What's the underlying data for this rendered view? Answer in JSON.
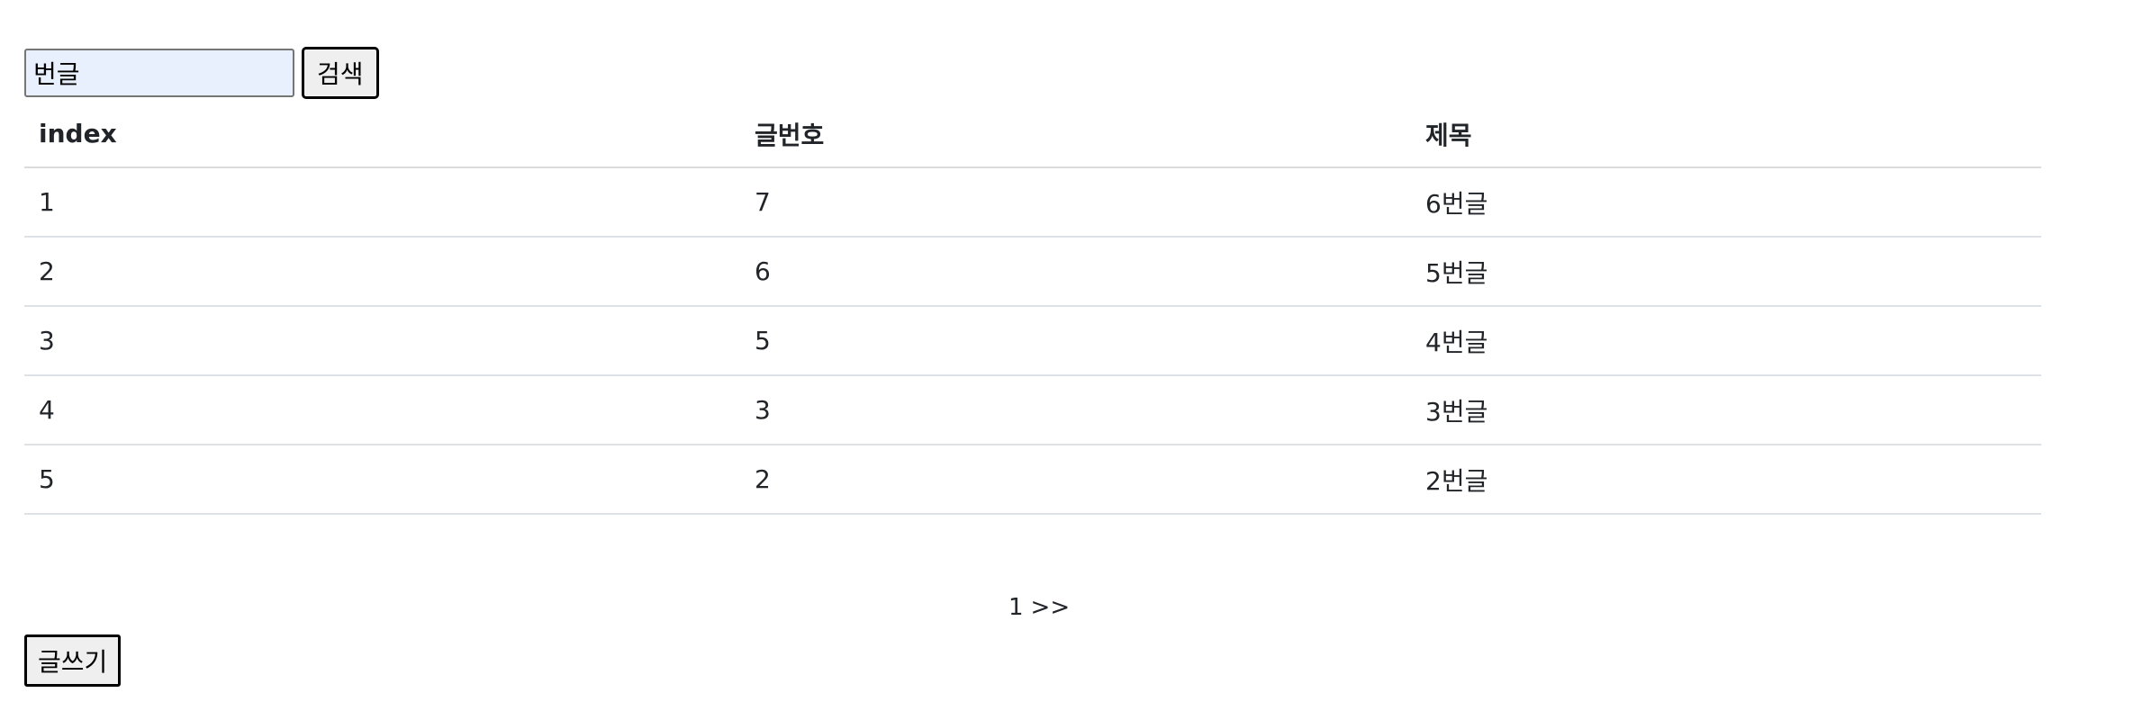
{
  "search": {
    "value": "번글",
    "button_label": "검색"
  },
  "table": {
    "headers": [
      "index",
      "글번호",
      "제목"
    ],
    "rows": [
      {
        "index": "1",
        "post_no": "7",
        "title": "6번글"
      },
      {
        "index": "2",
        "post_no": "6",
        "title": "5번글"
      },
      {
        "index": "3",
        "post_no": "5",
        "title": "4번글"
      },
      {
        "index": "4",
        "post_no": "3",
        "title": "3번글"
      },
      {
        "index": "5",
        "post_no": "2",
        "title": "2번글"
      }
    ]
  },
  "pagination": {
    "current_page": "1",
    "next_label": ">>"
  },
  "write_button_label": "글쓰기"
}
